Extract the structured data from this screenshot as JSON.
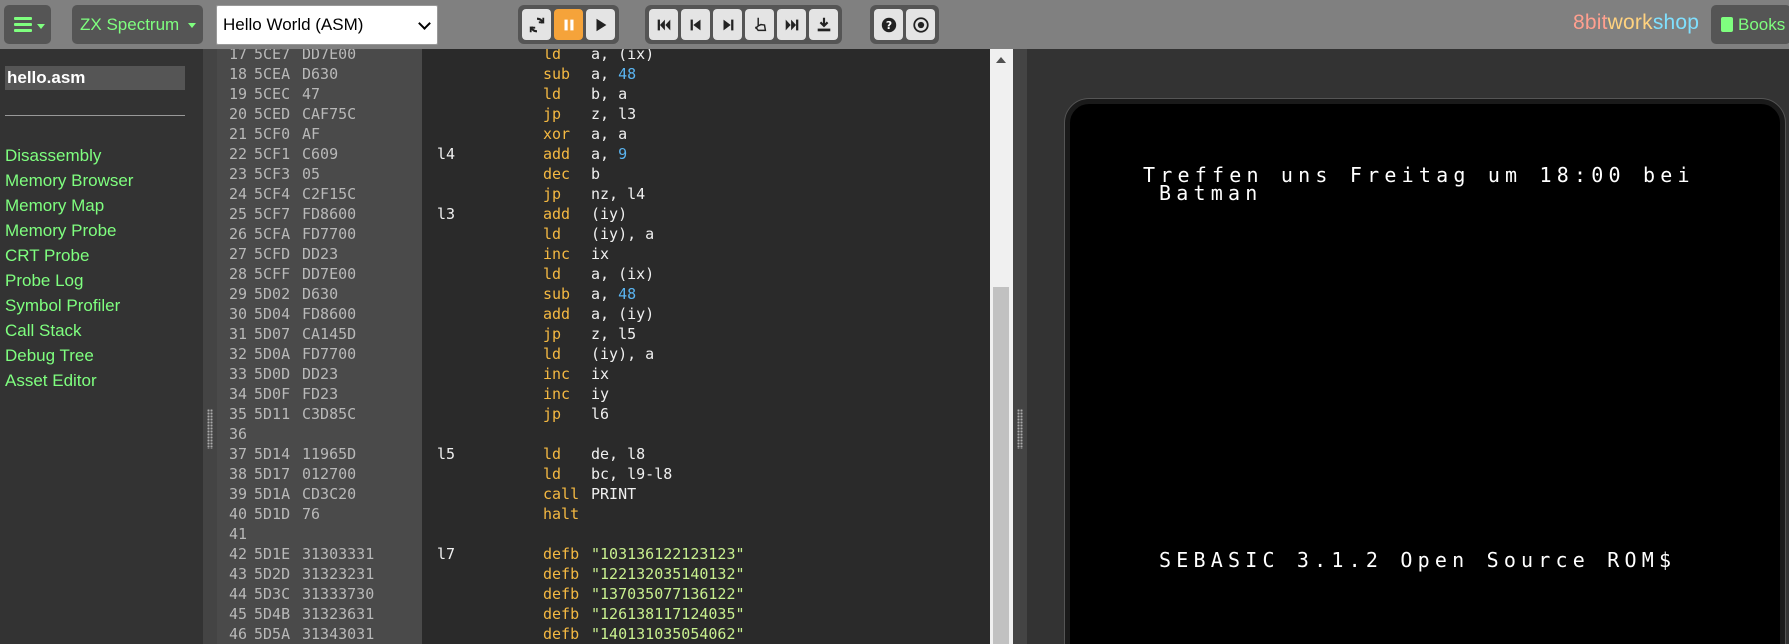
{
  "toolbar": {
    "platform": "ZX Spectrum",
    "preset": "Hello World (ASM)",
    "brand": {
      "a": "8bit",
      "b": "work",
      "c": "shop"
    },
    "books": "Books",
    "icons": [
      "menu-icon",
      "reset-icon",
      "pause-icon",
      "run-icon",
      "rewind-icon",
      "step-back-icon",
      "step-over-icon",
      "step-into-icon",
      "fast-forward-icon",
      "download-icon",
      "help-icon",
      "record-icon"
    ]
  },
  "sidebar": {
    "file": "hello.asm",
    "tools": [
      "Disassembly",
      "Memory Browser",
      "Memory Map",
      "Memory Probe",
      "CRT Probe",
      "Probe Log",
      "Symbol Profiler",
      "Call Stack",
      "Debug Tree",
      "Asset Editor"
    ]
  },
  "editor": {
    "lines": [
      {
        "n": "17",
        "addr": "5CE7",
        "hex": "DD7E00",
        "label": "",
        "op": "ld",
        "args": [
          {
            "t": "a, (ix)"
          }
        ]
      },
      {
        "n": "18",
        "addr": "5CEA",
        "hex": "D630",
        "label": "",
        "op": "sub",
        "args": [
          {
            "t": "a, "
          },
          {
            "t": "48",
            "k": "num"
          }
        ]
      },
      {
        "n": "19",
        "addr": "5CEC",
        "hex": "47",
        "label": "",
        "op": "ld",
        "args": [
          {
            "t": "b, a"
          }
        ]
      },
      {
        "n": "20",
        "addr": "5CED",
        "hex": "CAF75C",
        "label": "",
        "op": "jp",
        "args": [
          {
            "t": "z, l3"
          }
        ]
      },
      {
        "n": "21",
        "addr": "5CF0",
        "hex": "AF",
        "label": "",
        "op": "xor",
        "args": [
          {
            "t": "a, a"
          }
        ]
      },
      {
        "n": "22",
        "addr": "5CF1",
        "hex": "C609",
        "label": "l4",
        "op": "add",
        "args": [
          {
            "t": "a, "
          },
          {
            "t": "9",
            "k": "num"
          }
        ]
      },
      {
        "n": "23",
        "addr": "5CF3",
        "hex": "05",
        "label": "",
        "op": "dec",
        "args": [
          {
            "t": "b"
          }
        ]
      },
      {
        "n": "24",
        "addr": "5CF4",
        "hex": "C2F15C",
        "label": "",
        "op": "jp",
        "args": [
          {
            "t": "nz, l4"
          }
        ]
      },
      {
        "n": "25",
        "addr": "5CF7",
        "hex": "FD8600",
        "label": "l3",
        "op": "add",
        "args": [
          {
            "t": "(iy)"
          }
        ]
      },
      {
        "n": "26",
        "addr": "5CFA",
        "hex": "FD7700",
        "label": "",
        "op": "ld",
        "args": [
          {
            "t": "(iy), a"
          }
        ]
      },
      {
        "n": "27",
        "addr": "5CFD",
        "hex": "DD23",
        "label": "",
        "op": "inc",
        "args": [
          {
            "t": "ix"
          }
        ]
      },
      {
        "n": "28",
        "addr": "5CFF",
        "hex": "DD7E00",
        "label": "",
        "op": "ld",
        "args": [
          {
            "t": "a, (ix)"
          }
        ]
      },
      {
        "n": "29",
        "addr": "5D02",
        "hex": "D630",
        "label": "",
        "op": "sub",
        "args": [
          {
            "t": "a, "
          },
          {
            "t": "48",
            "k": "num"
          }
        ]
      },
      {
        "n": "30",
        "addr": "5D04",
        "hex": "FD8600",
        "label": "",
        "op": "add",
        "args": [
          {
            "t": "a, (iy)"
          }
        ]
      },
      {
        "n": "31",
        "addr": "5D07",
        "hex": "CA145D",
        "label": "",
        "op": "jp",
        "args": [
          {
            "t": "z, l5"
          }
        ]
      },
      {
        "n": "32",
        "addr": "5D0A",
        "hex": "FD7700",
        "label": "",
        "op": "ld",
        "args": [
          {
            "t": "(iy), a"
          }
        ]
      },
      {
        "n": "33",
        "addr": "5D0D",
        "hex": "DD23",
        "label": "",
        "op": "inc",
        "args": [
          {
            "t": "ix"
          }
        ]
      },
      {
        "n": "34",
        "addr": "5D0F",
        "hex": "FD23",
        "label": "",
        "op": "inc",
        "args": [
          {
            "t": "iy"
          }
        ]
      },
      {
        "n": "35",
        "addr": "5D11",
        "hex": "C3D85C",
        "label": "",
        "op": "jp",
        "args": [
          {
            "t": "l6"
          }
        ]
      },
      {
        "n": "36",
        "addr": "",
        "hex": "",
        "label": "",
        "op": "",
        "args": []
      },
      {
        "n": "37",
        "addr": "5D14",
        "hex": "11965D",
        "label": "l5",
        "op": "ld",
        "args": [
          {
            "t": "de, l8"
          }
        ]
      },
      {
        "n": "38",
        "addr": "5D17",
        "hex": "012700",
        "label": "",
        "op": "ld",
        "args": [
          {
            "t": "bc, l9-l8"
          }
        ]
      },
      {
        "n": "39",
        "addr": "5D1A",
        "hex": "CD3C20",
        "label": "",
        "op": "call",
        "args": [
          {
            "t": "PRINT"
          }
        ]
      },
      {
        "n": "40",
        "addr": "5D1D",
        "hex": "76",
        "label": "",
        "op": "halt",
        "args": []
      },
      {
        "n": "41",
        "addr": "",
        "hex": "",
        "label": "",
        "op": "",
        "args": []
      },
      {
        "n": "42",
        "addr": "5D1E",
        "hex": "31303331",
        "label": "l7",
        "op": "defb",
        "args": [
          {
            "t": "\"103136122123123\"",
            "k": "str"
          }
        ]
      },
      {
        "n": "43",
        "addr": "5D2D",
        "hex": "31323231",
        "label": "",
        "op": "defb",
        "args": [
          {
            "t": "\"122132035140132\"",
            "k": "str"
          }
        ]
      },
      {
        "n": "44",
        "addr": "5D3C",
        "hex": "31333730",
        "label": "",
        "op": "defb",
        "args": [
          {
            "t": "\"137035077136122\"",
            "k": "str"
          }
        ]
      },
      {
        "n": "45",
        "addr": "5D4B",
        "hex": "31323631",
        "label": "",
        "op": "defb",
        "args": [
          {
            "t": "\"126138117124035\"",
            "k": "str"
          }
        ]
      },
      {
        "n": "46",
        "addr": "5D5A",
        "hex": "31343031",
        "label": "",
        "op": "defb",
        "args": [
          {
            "t": "\"140131035054062\"",
            "k": "str"
          }
        ]
      }
    ]
  },
  "emulator": {
    "line1": "Treffen uns Freitag um 18:00 bei",
    "line2": "Batman",
    "rom": "SEBASIC 3.1.2 Open Source ROM$"
  }
}
